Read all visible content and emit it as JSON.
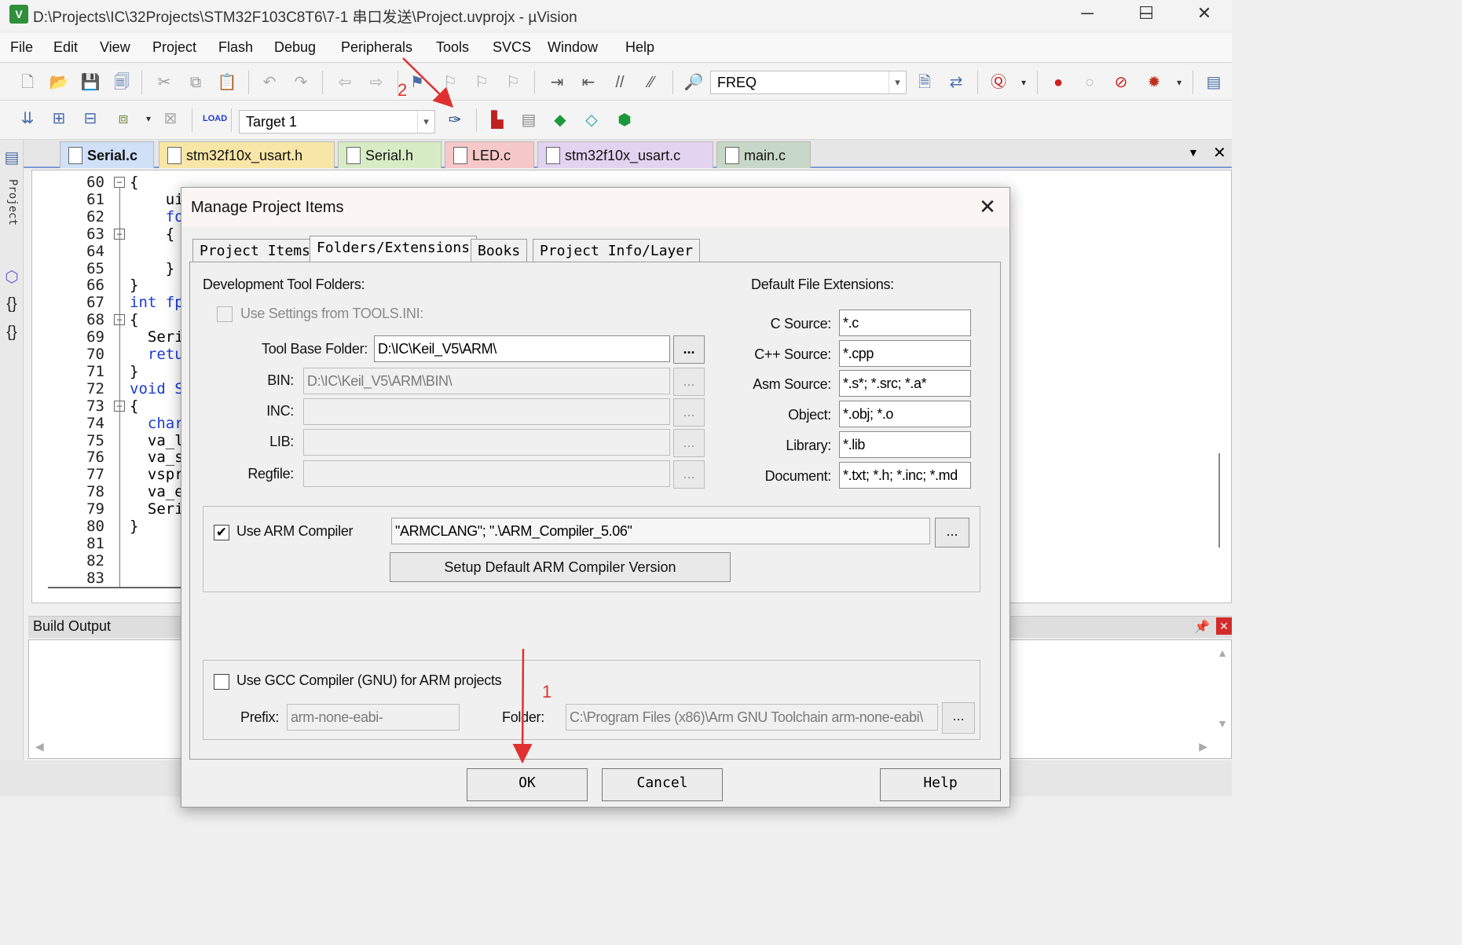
{
  "window": {
    "title": "D:\\Projects\\IC\\32Projects\\STM32F103C8T6\\7-1 串口发送\\Project.uvprojx - µVision",
    "app_icon_glyph": "V",
    "minimize": "─",
    "maximize": "☐",
    "close": "✕"
  },
  "menu": [
    "File",
    "Edit",
    "View",
    "Project",
    "Flash",
    "Debug",
    "Peripherals",
    "Tools",
    "SVCS",
    "Window",
    "Help"
  ],
  "toolbar1": {
    "search_combo_value": "FREQ"
  },
  "toolbar2": {
    "target_combo_value": "Target 1"
  },
  "side_panel": {
    "label": "Project"
  },
  "editor_tabs": [
    {
      "label": "Serial.c",
      "color": "#cfe0f7",
      "active": true
    },
    {
      "label": "stm32f10x_usart.h",
      "color": "#f7e6a6"
    },
    {
      "label": "Serial.h",
      "color": "#d7ecc4"
    },
    {
      "label": "LED.c",
      "color": "#f7c8c8"
    },
    {
      "label": "stm32f10x_usart.c",
      "color": "#e3d2f0"
    },
    {
      "label": "main.c",
      "color": "#c8d8c8"
    }
  ],
  "code_lines": [
    {
      "num": "60",
      "fold": "⊟",
      "text": "{",
      "kw": false
    },
    {
      "num": "61",
      "fold": "",
      "text": "    ui",
      "kw": false
    },
    {
      "num": "62",
      "fold": "",
      "text": "    fo",
      "kw": true
    },
    {
      "num": "63",
      "fold": "⊟",
      "text": "    {",
      "kw": false
    },
    {
      "num": "64",
      "fold": "",
      "text": "",
      "kw": false
    },
    {
      "num": "65",
      "fold": "",
      "text": "    }",
      "kw": false
    },
    {
      "num": "66",
      "fold": "",
      "text": "}",
      "kw": false
    },
    {
      "num": "67",
      "fold": "",
      "text": "int fp",
      "kw": true
    },
    {
      "num": "68",
      "fold": "⊟",
      "text": "{",
      "kw": false
    },
    {
      "num": "69",
      "fold": "",
      "text": "  Seri",
      "kw": false
    },
    {
      "num": "70",
      "fold": "",
      "text": "  retu",
      "kw": true
    },
    {
      "num": "71",
      "fold": "",
      "text": "}",
      "kw": false
    },
    {
      "num": "72",
      "fold": "",
      "text": "void S",
      "kw": true
    },
    {
      "num": "73",
      "fold": "⊟",
      "text": "{",
      "kw": false
    },
    {
      "num": "74",
      "fold": "",
      "text": "  char",
      "kw": true
    },
    {
      "num": "75",
      "fold": "",
      "text": "  va_l",
      "kw": false
    },
    {
      "num": "76",
      "fold": "",
      "text": "  va_s",
      "kw": false
    },
    {
      "num": "77",
      "fold": "",
      "text": "  vspr",
      "kw": false
    },
    {
      "num": "78",
      "fold": "",
      "text": "  va_e",
      "kw": false
    },
    {
      "num": "79",
      "fold": "",
      "text": "  Seri",
      "kw": false
    },
    {
      "num": "80",
      "fold": "",
      "text": "}",
      "kw": false
    },
    {
      "num": "81",
      "fold": "",
      "text": "",
      "kw": false
    },
    {
      "num": "82",
      "fold": "",
      "text": "",
      "kw": false
    },
    {
      "num": "83",
      "fold": "",
      "text": "",
      "kw": false
    }
  ],
  "build_output": {
    "title": "Build Output"
  },
  "dialog": {
    "title": "Manage Project Items",
    "close": "✕",
    "tabs": [
      "Project Items",
      "Folders/Extensions",
      "Books",
      "Project Info/Layer"
    ],
    "active_tab": "Folders/Extensions",
    "dev_folders_title": "Development Tool Folders:",
    "use_tools_ini": "Use Settings from TOOLS.INI:",
    "tool_base_label": "Tool Base Folder:",
    "tool_base_value": "D:\\IC\\Keil_V5\\ARM\\",
    "bin_label": "BIN:",
    "bin_value": "D:\\IC\\Keil_V5\\ARM\\BIN\\",
    "inc_label": "INC:",
    "lib_label": "LIB:",
    "regfile_label": "Regfile:",
    "browse": "...",
    "ext_title": "Default File Extensions:",
    "extensions": [
      {
        "label": "C Source:",
        "value": "*.c"
      },
      {
        "label": "C++ Source:",
        "value": "*.cpp"
      },
      {
        "label": "Asm Source:",
        "value": "*.s*; *.src; *.a*"
      },
      {
        "label": "Object:",
        "value": "*.obj; *.o"
      },
      {
        "label": "Library:",
        "value": "*.lib"
      },
      {
        "label": "Document:",
        "value": "*.txt; *.h; *.inc; *.md"
      }
    ],
    "use_arm_compiler": "Use ARM Compiler",
    "arm_compiler_checked": true,
    "arm_compiler_value": "\"ARMCLANG\"; \".\\ARM_Compiler_5.06\"",
    "setup_default_btn": "Setup Default ARM Compiler Version",
    "use_gcc": "Use GCC Compiler (GNU) for ARM projects",
    "prefix_label": "Prefix:",
    "prefix_value": "arm-none-eabi-",
    "folder_label": "Folder:",
    "folder_value": "C:\\Program Files (x86)\\Arm GNU Toolchain arm-none-eabi\\",
    "ok": "OK",
    "cancel": "Cancel",
    "help": "Help"
  },
  "annotations": {
    "step1": "1",
    "step2": "2",
    "color": "#e03030"
  }
}
